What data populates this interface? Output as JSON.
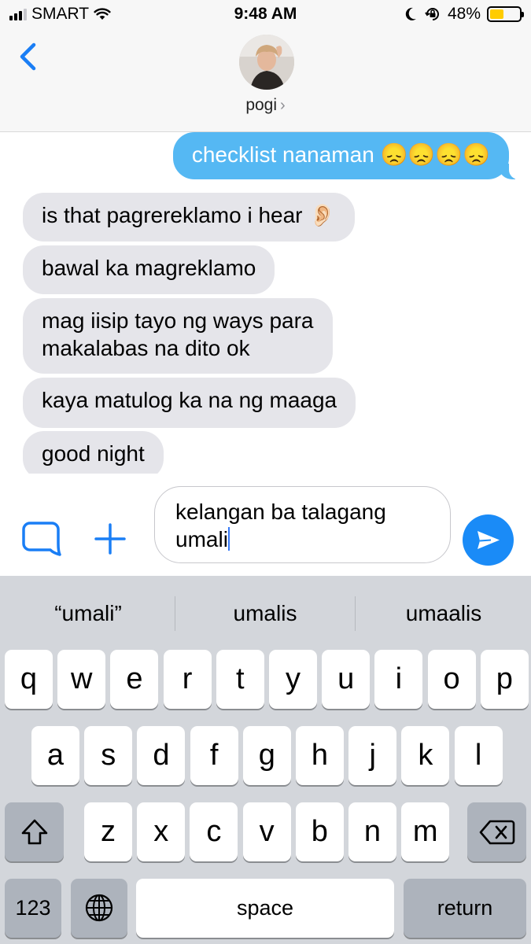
{
  "status_bar": {
    "carrier": "SMART",
    "time": "9:48 AM",
    "battery_percent": "48%",
    "battery_level": 0.48,
    "battery_color": "#ffcc00",
    "signal_bars_active": 3,
    "icons": [
      "signal-icon",
      "wifi-icon",
      "moon-icon",
      "orientation-lock-icon",
      "battery-icon"
    ]
  },
  "header": {
    "back_icon": "chevron-left-icon",
    "contact_name": "pogi",
    "chevron": "›"
  },
  "messages": [
    {
      "side": "sent",
      "text": "checklist nanaman 😞😞😞😞"
    },
    {
      "side": "received",
      "text": "is that pagrereklamo i hear 👂🏻"
    },
    {
      "side": "received",
      "text": "bawal ka magreklamo"
    },
    {
      "side": "received",
      "text": "mag iisip tayo ng ways para",
      "text2": "makalabas na dito ok"
    },
    {
      "side": "received",
      "text": "kaya matulog ka na ng maaga"
    },
    {
      "side": "received",
      "text": "good night"
    }
  ],
  "composer": {
    "line1": "kelangan ba talagang",
    "line2": "umali",
    "apps_icon": "app-store-icon",
    "plus_icon": "plus-icon",
    "send_icon": "send-arrow-icon",
    "accent_color": "#1a8bf7"
  },
  "keyboard": {
    "suggestions": [
      "“umali”",
      "umalis",
      "umaalis"
    ],
    "row1": [
      "q",
      "w",
      "e",
      "r",
      "t",
      "y",
      "u",
      "i",
      "o",
      "p"
    ],
    "row2": [
      "a",
      "s",
      "d",
      "f",
      "g",
      "h",
      "j",
      "k",
      "l"
    ],
    "row3": [
      "z",
      "x",
      "c",
      "v",
      "b",
      "n",
      "m"
    ],
    "shift_icon": "shift-icon",
    "delete_icon": "backspace-icon",
    "numbers_key": "123",
    "globe_icon": "globe-icon",
    "space_key": "space",
    "return_key": "return"
  }
}
